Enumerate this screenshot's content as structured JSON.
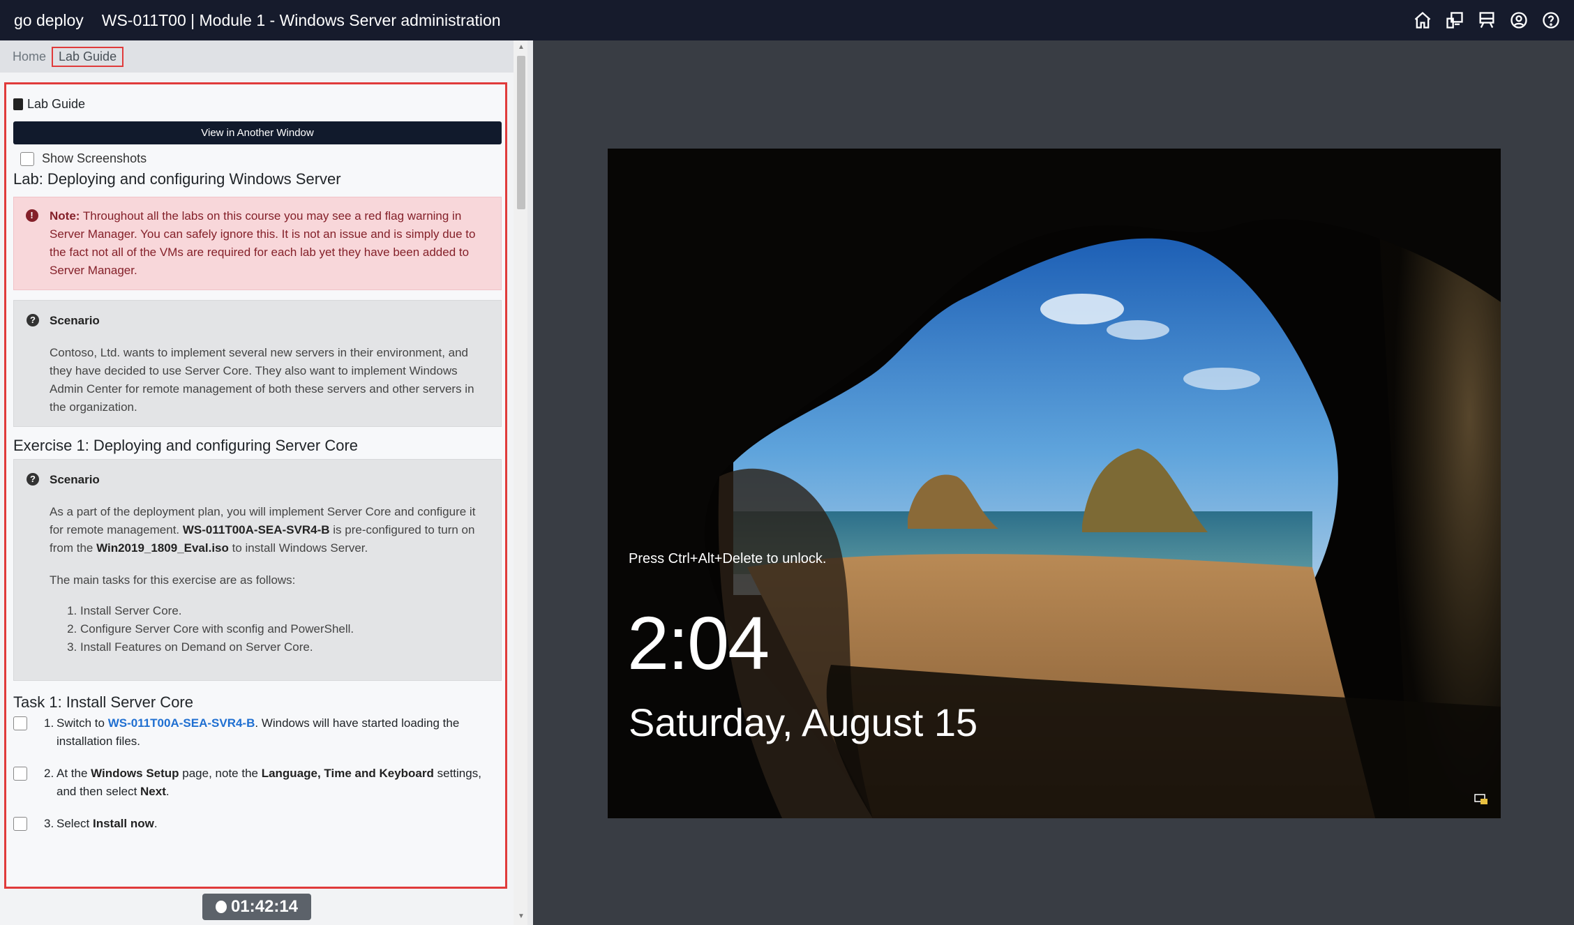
{
  "header": {
    "brand": "go deploy",
    "title": "WS-011T00 | Module 1 - Windows Server administration",
    "icons": [
      "home-icon",
      "deploy-icon",
      "lab-icon",
      "account-icon",
      "help-icon"
    ]
  },
  "breadcrumb": {
    "home": "Home",
    "current": "Lab Guide"
  },
  "guide": {
    "header": "Lab Guide",
    "view_button": "View in Another Window",
    "show_screenshots": "Show Screenshots",
    "lab_title": "Lab: Deploying and configuring Windows Server",
    "note": {
      "label": "Note:",
      "text": " Throughout all the labs on this course you may see a red flag warning in Server Manager. You can safely ignore this. It is not an issue and is simply due to the fact not all of the VMs are required for each lab yet they have been added to Server Manager."
    },
    "scenario1": {
      "title": "Scenario",
      "text": "Contoso, Ltd. wants to implement several new servers in their environment, and they have decided to use Server Core. They also want to implement Windows Admin Center for remote management of both these servers and other servers in the organization."
    },
    "exercise_title": "Exercise 1: Deploying and configuring Server Core",
    "scenario2": {
      "title": "Scenario",
      "p1_a": "As a part of the deployment plan, you will implement Server Core and configure it for remote management. ",
      "p1_b": "WS-011T00A-SEA-SVR4-B",
      "p1_c": " is pre-configured to turn on from the ",
      "p1_d": "Win2019_1809_Eval.iso",
      "p1_e": " to install Windows Server.",
      "p2": "The main tasks for this exercise are as follows:",
      "list": [
        "Install Server Core.",
        "Configure Server Core with sconfig and PowerShell.",
        "Install Features on Demand on Server Core."
      ]
    },
    "task_title": "Task 1: Install Server Core",
    "steps": {
      "s1_num": "1.",
      "s1_a": "Switch to ",
      "s1_link": "WS-011T00A-SEA-SVR4-B",
      "s1_b": ". Windows will have started loading the",
      "s1_c": "installation files.",
      "s2_num": "2.",
      "s2_a": "At the ",
      "s2_b": "Windows Setup",
      "s2_c": " page, note the ",
      "s2_d": "Language, Time and Keyboard",
      "s2_e": " settings,",
      "s2_f": "and then select ",
      "s2_g": "Next",
      "s2_h": ".",
      "s3_num": "3.",
      "s3_a": "Select ",
      "s3_b": "Install now",
      "s3_c": "."
    }
  },
  "timer": "01:42:14",
  "vm": {
    "hint": "Press Ctrl+Alt+Delete to unlock.",
    "time": "2:04",
    "date": "Saturday, August 15"
  }
}
